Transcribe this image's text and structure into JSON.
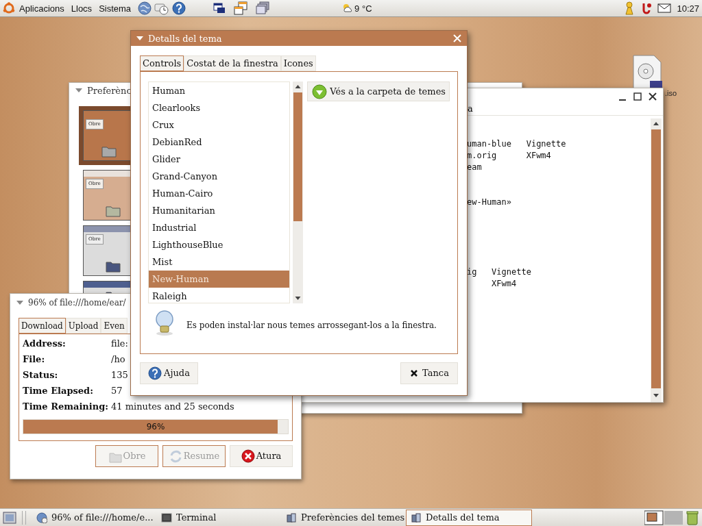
{
  "top_panel": {
    "menus": [
      "Aplicacions",
      "Llocs",
      "Sistema"
    ],
    "weather": "9 °C",
    "clock": "10:27"
  },
  "desktop_icon": {
    "label": ".iso"
  },
  "preferences_window": {
    "title": "Preferènc",
    "previews": [
      {
        "kind": "brown",
        "button": "Obre",
        "selected": true
      },
      {
        "kind": "tan",
        "button": "Obre",
        "selected": false
      },
      {
        "kind": "gray",
        "button": "Obre",
        "selected": false
      },
      {
        "kind": "navy",
        "selected": false
      }
    ]
  },
  "terminal_window": {
    "menu_fragment": "a",
    "output": "uman-blue   Vignette\nm.orig      XFwm4\neam\n\n\new-Human»\n\n\n\n\n\nig   Vignette\n     XFwm4"
  },
  "download_window": {
    "title": "96% of file:///home/ear/",
    "tabs": [
      {
        "label": "Download",
        "selected": true
      },
      {
        "label": "Upload",
        "selected": false
      },
      {
        "label": "Even",
        "selected": false
      }
    ],
    "fields": [
      {
        "label": "Address:",
        "value": "file:"
      },
      {
        "label": "File:",
        "value": "/ho"
      },
      {
        "label": "Status:",
        "value": "135"
      },
      {
        "label": "Time Elapsed:",
        "value": "57"
      },
      {
        "label": "Time Remaining:",
        "value": "41 minutes and 25 seconds"
      }
    ],
    "progress": {
      "level": 0.96,
      "text": "96%"
    },
    "buttons": [
      {
        "kind": "open",
        "label": "Obre",
        "disabled": true
      },
      {
        "kind": "resume",
        "label": "Resume",
        "disabled": true
      },
      {
        "kind": "stop",
        "label": "Atura",
        "disabled": false
      }
    ]
  },
  "theme_dialog": {
    "title": "Detalls del tema",
    "tabs": [
      {
        "label": "Controls",
        "selected": true
      },
      {
        "label": "Costat de la finestra",
        "selected": false
      },
      {
        "label": "Icones",
        "selected": false
      }
    ],
    "themes": [
      {
        "name": "Human",
        "selected": false
      },
      {
        "name": "Clearlooks",
        "selected": false
      },
      {
        "name": "Crux",
        "selected": false
      },
      {
        "name": "DebianRed",
        "selected": false
      },
      {
        "name": "Glider",
        "selected": false
      },
      {
        "name": "Grand-Canyon",
        "selected": false
      },
      {
        "name": "Human-Cairo",
        "selected": false
      },
      {
        "name": "Humanitarian",
        "selected": false
      },
      {
        "name": "Industrial",
        "selected": false
      },
      {
        "name": "LighthouseBlue",
        "selected": false
      },
      {
        "name": "Mist",
        "selected": false
      },
      {
        "name": "New-Human",
        "selected": true
      },
      {
        "name": "Raleigh",
        "selected": false
      }
    ],
    "folder_button": "Vés a la carpeta de temes",
    "hint": "Es poden instal·lar nous temes arrossegant-los a la finestra.",
    "help_button": "Ajuda",
    "close_button": "Tanca"
  },
  "taskbar": {
    "items": [
      {
        "kind": "download",
        "label": "96% of file:///home/e...",
        "selected": false
      },
      {
        "kind": "terminal",
        "label": "Terminal",
        "selected": false
      },
      {
        "kind": "theme",
        "label": "Preferències del temes",
        "selected": false
      },
      {
        "kind": "theme",
        "label": "Detalls del tema",
        "selected": true
      }
    ]
  }
}
